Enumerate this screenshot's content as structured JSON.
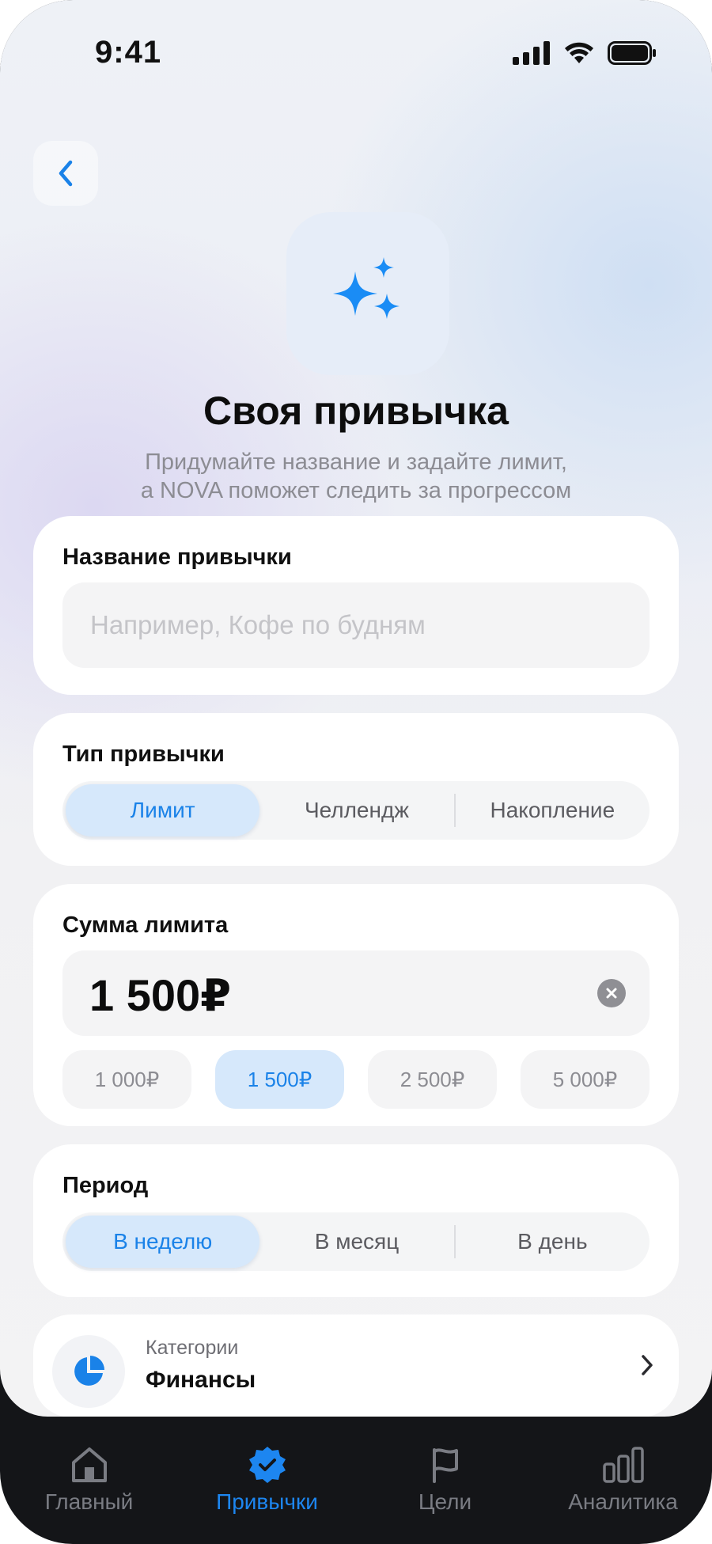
{
  "status_bar": {
    "time": "9:41"
  },
  "header": {
    "title": "Своя привычка",
    "subtitle_line1": "Придумайте название и задайте лимит,",
    "subtitle_line2": "а NOVA поможет следить за прогрессом"
  },
  "name_section": {
    "label": "Название привычки",
    "placeholder": "Например, Кофе по будням",
    "value": ""
  },
  "type_section": {
    "label": "Тип привычки",
    "options": [
      "Лимит",
      "Челлендж",
      "Накопление"
    ],
    "selected": "Лимит"
  },
  "amount_section": {
    "label": "Сумма лимита",
    "value": "1 500₽",
    "presets": [
      "1 000₽",
      "1 500₽",
      "2 500₽",
      "5 000₽"
    ],
    "selected_preset": "1 500₽"
  },
  "period_section": {
    "label": "Период",
    "options": [
      "В неделю",
      "В месяц",
      "В день"
    ],
    "selected": "В неделю"
  },
  "category": {
    "label": "Категории",
    "value": "Финансы"
  },
  "tabbar": {
    "tabs": [
      {
        "label": "Главный",
        "icon": "home-icon"
      },
      {
        "label": "Привычки",
        "icon": "verified-badge-icon"
      },
      {
        "label": "Цели",
        "icon": "flag-icon"
      },
      {
        "label": "Аналитика",
        "icon": "bar-chart-icon"
      }
    ],
    "active": "Привычки"
  },
  "colors": {
    "accent": "#1a82e8",
    "accent_light": "#d6e8fb",
    "tabbar_bg": "#141518"
  }
}
